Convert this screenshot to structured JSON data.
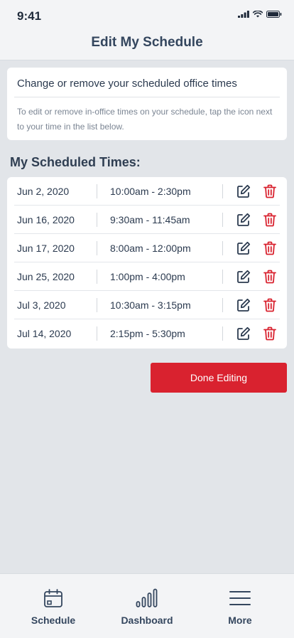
{
  "status": {
    "time": "9:41"
  },
  "header": {
    "title": "Edit My Schedule"
  },
  "info": {
    "title": "Change or remove your scheduled office times",
    "description": "To edit or remove in-office times on your schedule, tap the icon next to your time in the list below."
  },
  "section": {
    "heading": "My Scheduled Times:"
  },
  "schedule": [
    {
      "date": "Jun 2, 2020",
      "time": "10:00am - 2:30pm"
    },
    {
      "date": "Jun 16, 2020",
      "time": "9:30am - 11:45am"
    },
    {
      "date": "Jun 17, 2020",
      "time": "8:00am - 12:00pm"
    },
    {
      "date": "Jun 25, 2020",
      "time": "1:00pm - 4:00pm"
    },
    {
      "date": "Jul 3, 2020",
      "time": "10:30am - 3:15pm"
    },
    {
      "date": "Jul 14, 2020",
      "time": "2:15pm - 5:30pm"
    }
  ],
  "actions": {
    "done_label": "Done Editing"
  },
  "tabs": [
    {
      "label": "Schedule",
      "icon": "calendar-icon"
    },
    {
      "label": "Dashboard",
      "icon": "bar-chart-icon"
    },
    {
      "label": "More",
      "icon": "menu-icon"
    }
  ],
  "colors": {
    "accent": "#d9222f",
    "text": "#2b3a4f",
    "background": "#e2e5e9"
  }
}
